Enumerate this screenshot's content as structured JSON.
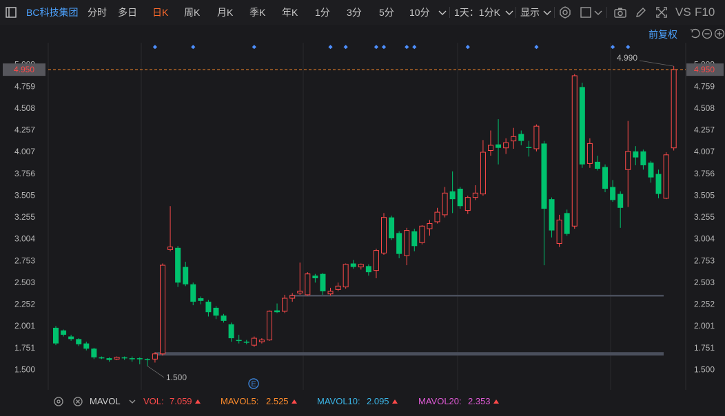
{
  "toolbar": {
    "stock_name": "BC科技集团",
    "tabs": [
      "分时",
      "多日",
      "日K",
      "周K",
      "月K",
      "季K",
      "年K",
      "1分",
      "3分",
      "5分",
      "10分"
    ],
    "active_tab": "日K",
    "period_select": "1天：1分K",
    "display_label": "显示",
    "vs_label": "VS",
    "f10_label": "F10"
  },
  "adjust_label": "前复权",
  "chart_data": {
    "type": "candlestick",
    "y_ticks": [
      "1.500",
      "1.751",
      "2.001",
      "2.252",
      "2.503",
      "2.753",
      "3.004",
      "3.255",
      "3.505",
      "3.756",
      "4.007",
      "4.257",
      "4.508",
      "4.759",
      "5.009"
    ],
    "ylim": [
      1.4,
      5.15
    ],
    "current_price": "4.950",
    "max_label": "4.990",
    "min_label": "1.500",
    "support_lines": [
      2.35,
      1.68
    ],
    "event_marker": "E",
    "candles": [
      [
        1.98,
        1.8,
        2.0,
        1.78
      ],
      [
        1.95,
        1.9,
        1.96,
        1.88
      ],
      [
        1.88,
        1.85,
        1.9,
        1.83
      ],
      [
        1.85,
        1.79,
        1.86,
        1.77
      ],
      [
        1.8,
        1.74,
        1.82,
        1.72
      ],
      [
        1.74,
        1.64,
        1.75,
        1.62
      ],
      [
        1.64,
        1.63,
        1.65,
        1.62
      ],
      [
        1.63,
        1.61,
        1.64,
        1.59
      ],
      [
        1.62,
        1.64,
        1.65,
        1.61
      ],
      [
        1.64,
        1.63,
        1.65,
        1.61
      ],
      [
        1.63,
        1.62,
        1.65,
        1.59
      ],
      [
        1.63,
        1.62,
        1.64,
        1.56
      ],
      [
        1.62,
        1.61,
        1.63,
        1.54
      ],
      [
        1.62,
        1.68,
        1.7,
        1.58
      ],
      [
        1.68,
        2.7,
        2.72,
        1.66
      ],
      [
        2.88,
        2.91,
        3.38,
        2.86
      ],
      [
        2.9,
        2.5,
        2.92,
        2.45
      ],
      [
        2.68,
        2.48,
        2.74,
        2.46
      ],
      [
        2.48,
        2.28,
        2.5,
        2.24
      ],
      [
        2.32,
        2.29,
        2.34,
        2.25
      ],
      [
        2.28,
        2.16,
        2.3,
        2.11
      ],
      [
        2.21,
        2.12,
        2.23,
        2.08
      ],
      [
        2.12,
        2.06,
        2.14,
        2.04
      ],
      [
        2.02,
        1.86,
        2.04,
        1.82
      ],
      [
        1.84,
        1.83,
        1.9,
        1.8
      ],
      [
        1.82,
        1.81,
        1.84,
        1.79
      ],
      [
        1.78,
        1.86,
        1.88,
        1.76
      ],
      [
        1.82,
        1.84,
        1.86,
        1.8
      ],
      [
        1.84,
        2.17,
        2.18,
        1.83
      ],
      [
        2.18,
        2.16,
        2.26,
        2.15
      ],
      [
        2.17,
        2.32,
        2.36,
        2.15
      ],
      [
        2.32,
        2.35,
        2.38,
        2.28
      ],
      [
        2.38,
        2.4,
        2.73,
        2.36
      ],
      [
        2.36,
        2.6,
        2.62,
        2.35
      ],
      [
        2.58,
        2.55,
        2.6,
        2.5
      ],
      [
        2.6,
        2.4,
        2.61,
        2.36
      ],
      [
        2.37,
        2.4,
        2.44,
        2.35
      ],
      [
        2.42,
        2.46,
        2.5,
        2.4
      ],
      [
        2.45,
        2.71,
        2.72,
        2.43
      ],
      [
        2.72,
        2.68,
        2.76,
        2.66
      ],
      [
        2.68,
        2.71,
        2.72,
        2.65
      ],
      [
        2.69,
        2.62,
        2.71,
        2.58
      ],
      [
        2.64,
        2.87,
        2.89,
        2.55
      ],
      [
        2.84,
        3.25,
        3.3,
        2.82
      ],
      [
        3.25,
        3.01,
        3.27,
        2.99
      ],
      [
        3.07,
        2.83,
        3.09,
        2.78
      ],
      [
        2.81,
        3.1,
        3.13,
        2.7
      ],
      [
        3.09,
        2.92,
        3.12,
        2.86
      ],
      [
        2.96,
        3.15,
        3.16,
        2.94
      ],
      [
        3.12,
        3.18,
        3.22,
        3.04
      ],
      [
        3.2,
        3.31,
        3.36,
        3.18
      ],
      [
        3.28,
        3.53,
        3.6,
        3.25
      ],
      [
        3.55,
        3.46,
        3.78,
        3.3
      ],
      [
        3.58,
        3.38,
        3.6,
        3.35
      ],
      [
        3.33,
        3.48,
        3.5,
        3.29
      ],
      [
        3.48,
        3.53,
        3.62,
        3.45
      ],
      [
        3.52,
        4.0,
        4.14,
        3.5
      ],
      [
        4.02,
        4.08,
        4.25,
        3.96
      ],
      [
        4.09,
        4.05,
        4.38,
        3.86
      ],
      [
        4.05,
        4.11,
        4.16,
        3.98
      ],
      [
        4.13,
        4.18,
        4.28,
        4.04
      ],
      [
        4.21,
        4.13,
        4.25,
        4.08
      ],
      [
        4.06,
        4.05,
        4.13,
        3.95
      ],
      [
        4.04,
        4.3,
        4.32,
        4.01
      ],
      [
        4.1,
        3.35,
        4.13,
        2.7
      ],
      [
        3.46,
        3.1,
        3.48,
        3.02
      ],
      [
        2.95,
        3.22,
        3.28,
        2.91
      ],
      [
        3.3,
        3.06,
        3.34,
        3.04
      ],
      [
        3.15,
        4.88,
        4.9,
        3.12
      ],
      [
        4.75,
        3.86,
        4.8,
        3.82
      ],
      [
        3.87,
        4.1,
        4.16,
        3.82
      ],
      [
        3.89,
        3.81,
        3.96,
        3.79
      ],
      [
        3.83,
        3.58,
        3.86,
        3.54
      ],
      [
        3.6,
        3.45,
        3.68,
        3.43
      ],
      [
        3.52,
        3.36,
        3.55,
        3.13
      ],
      [
        3.8,
        4.01,
        4.36,
        3.37
      ],
      [
        4.01,
        3.94,
        4.07,
        3.85
      ],
      [
        4.01,
        3.85,
        4.03,
        3.8
      ],
      [
        3.88,
        3.71,
        3.9,
        3.65
      ],
      [
        3.75,
        3.52,
        3.8,
        3.47
      ],
      [
        3.47,
        3.97,
        4.0,
        3.46
      ],
      [
        4.05,
        4.95,
        4.99,
        4.02
      ]
    ],
    "markers": [
      13,
      18,
      26,
      36,
      38,
      42,
      43,
      46,
      47,
      54,
      63,
      73,
      75
    ]
  },
  "bottom": {
    "indicator": "MAVOL",
    "vol": {
      "label": "VOL:",
      "value": "7.059"
    },
    "mavol5": {
      "label": "MAVOL5:",
      "value": "2.525"
    },
    "mavol10": {
      "label": "MAVOL10:",
      "value": "2.095"
    },
    "mavol20": {
      "label": "MAVOL20:",
      "value": "2.353"
    }
  },
  "colors": {
    "up": "#ff4a4a",
    "down": "#00c26e",
    "marker": "#4d8fff",
    "orange": "#ff8c2c",
    "cyan": "#3bb6e8",
    "pink": "#e05ad6"
  }
}
